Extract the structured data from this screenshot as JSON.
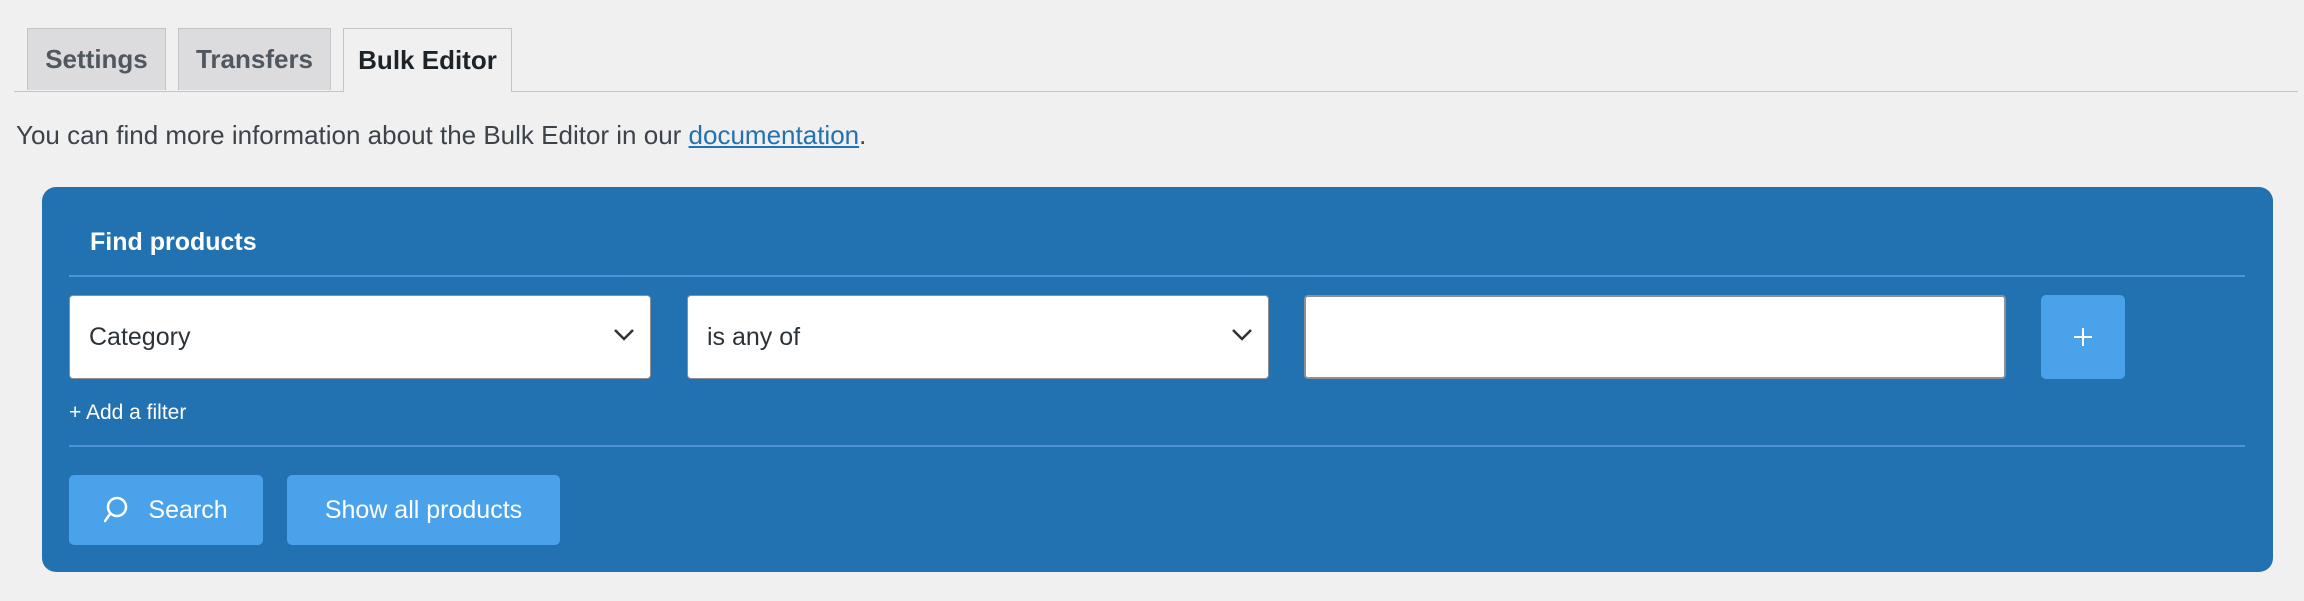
{
  "tabs": [
    {
      "label": "Settings",
      "active": false
    },
    {
      "label": "Transfers",
      "active": false
    },
    {
      "label": "Bulk Editor",
      "active": true
    }
  ],
  "info": {
    "prefix": "You can find more information about the Bulk Editor in our ",
    "link_text": "documentation",
    "suffix": "."
  },
  "panel": {
    "title": "Find products",
    "filter": {
      "field_value": "Category",
      "operator_value": "is any of",
      "value_input": "",
      "add_row_icon": "plus-icon"
    },
    "add_filter_label": "+ Add a filter",
    "search_label": "Search",
    "show_all_label": "Show all products"
  },
  "colors": {
    "panel_bg": "#2271b1",
    "button_bg": "#4aa3ea",
    "link": "#2271b1",
    "page_bg": "#f0f0f1"
  }
}
